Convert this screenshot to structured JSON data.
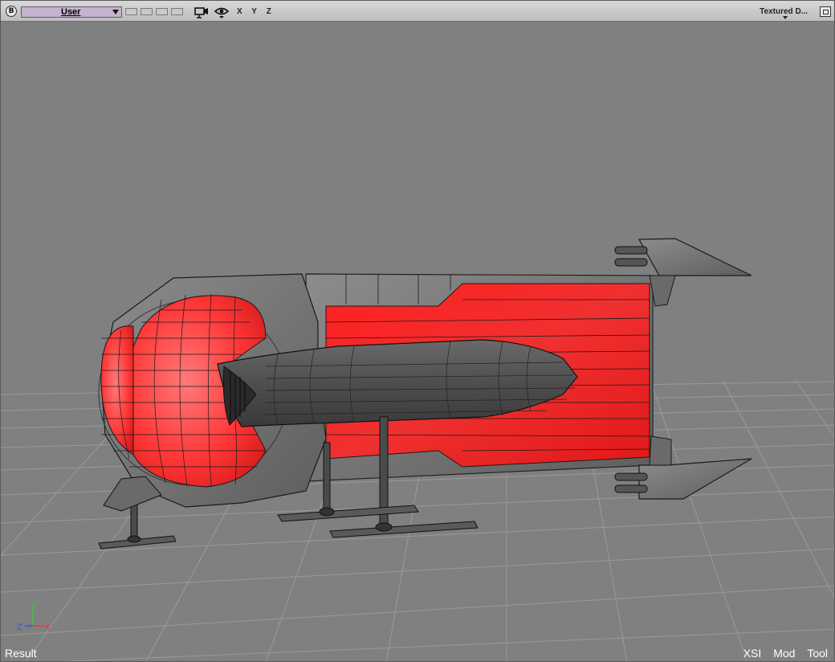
{
  "toolbar": {
    "b_button": "B",
    "camera_dropdown": "User",
    "axis_labels": [
      "X",
      "Y",
      "Z"
    ],
    "display_mode": "Textured D...",
    "icons": [
      "camera-icon",
      "eye-icon",
      "maximize-icon"
    ]
  },
  "viewport": {
    "background_color": "#808080",
    "grid_color": "#9a9a9a",
    "model_accent_color": "#ff3a3a",
    "model_hull_color": "#555555"
  },
  "status": {
    "result_label": "Result",
    "mode_buttons": [
      "XSI",
      "Mod",
      "Tool"
    ]
  },
  "axis_gizmo": {
    "y": "Y",
    "z": "Z",
    "x": "X"
  }
}
